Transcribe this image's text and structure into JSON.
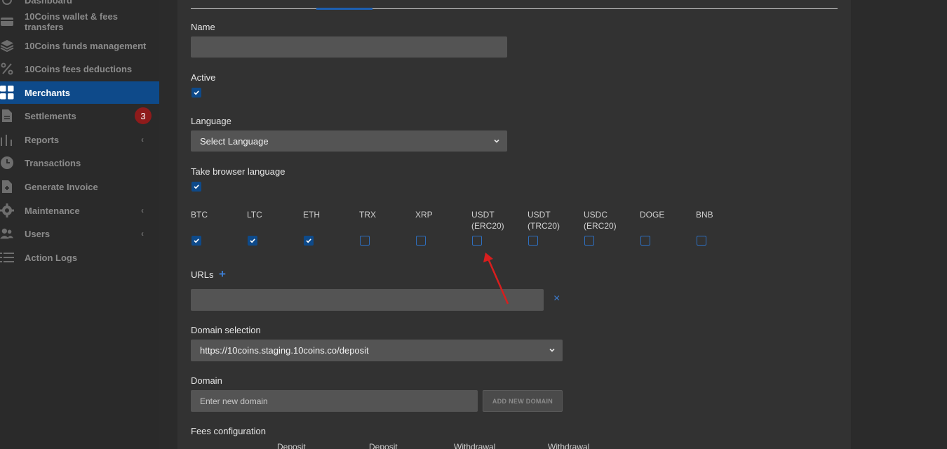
{
  "sidebar": {
    "items": [
      {
        "label": "Dashboard",
        "icon": "dashboard-icon",
        "chevron": false
      },
      {
        "label": "10Coins wallet & fees transfers",
        "icon": "wallet-icon",
        "chevron": false
      },
      {
        "label": "10Coins funds management",
        "icon": "layers-icon",
        "chevron": true
      },
      {
        "label": "10Coins fees deductions",
        "icon": "percent-icon",
        "chevron": false
      },
      {
        "label": "Merchants",
        "icon": "grid-icon",
        "chevron": false,
        "active": true
      },
      {
        "label": "Settlements",
        "icon": "document-icon",
        "chevron": false,
        "badge": "3"
      },
      {
        "label": "Reports",
        "icon": "bar-chart-icon",
        "chevron": true
      },
      {
        "label": "Transactions",
        "icon": "clock-icon",
        "chevron": false
      },
      {
        "label": "Generate Invoice",
        "icon": "file-plus-icon",
        "chevron": false
      },
      {
        "label": "Maintenance",
        "icon": "gear-icon",
        "chevron": true
      },
      {
        "label": "Users",
        "icon": "users-icon",
        "chevron": true
      },
      {
        "label": "Action Logs",
        "icon": "list-icon",
        "chevron": false
      }
    ],
    "chevron_glyph": "‹"
  },
  "form": {
    "name_label": "Name",
    "name_value": "",
    "active_label": "Active",
    "active_checked": true,
    "language_label": "Language",
    "language_value": "Select Language",
    "browser_lang_label": "Take browser language",
    "browser_lang_checked": true,
    "coins": [
      {
        "label": "BTC",
        "checked": true
      },
      {
        "label": "LTC",
        "checked": true
      },
      {
        "label": "ETH",
        "checked": true
      },
      {
        "label": "TRX",
        "checked": false
      },
      {
        "label": "XRP",
        "checked": false
      },
      {
        "label": "USDT\n(ERC20)",
        "checked": false
      },
      {
        "label": "USDT\n(TRC20)",
        "checked": false
      },
      {
        "label": "USDC\n(ERC20)",
        "checked": false
      },
      {
        "label": "DOGE",
        "checked": false
      },
      {
        "label": "BNB",
        "checked": false
      }
    ],
    "urls_label": "URLs",
    "add_url_glyph": "+",
    "url_value": "",
    "remove_url_glyph": "×",
    "domain_selection_label": "Domain selection",
    "domain_selection_value": "https://10coins.staging.10coins.co/deposit",
    "domain_label": "Domain",
    "domain_placeholder": "Enter new domain",
    "add_domain_label": "ADD NEW DOMAIN",
    "fees_label": "Fees configuration",
    "fees_columns": [
      "Deposit",
      "Deposit",
      "Withdrawal",
      "Withdrawal"
    ]
  },
  "colors": {
    "accent": "#0e4a8a",
    "annotation_arrow": "#d81e1e",
    "badge": "#8e1b1b"
  }
}
